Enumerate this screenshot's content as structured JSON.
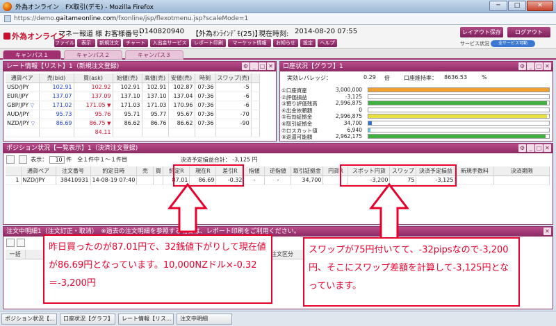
{
  "window": {
    "title": "外為オンライン　FX取引(デモ) - Mozilla Firefox",
    "min": "─",
    "max": "□",
    "close": "✕"
  },
  "urlbar": {
    "scheme": "https://demo.",
    "host": "gaitameonline.com",
    "path": "/fxonline/jsp/flexotmenu.jsp?scaleMode=1"
  },
  "header": {
    "logo": "外為オンライン",
    "user": "マネー報道 様",
    "account_label": "お客様番号：",
    "account": "D140820940",
    "plan": "【外為ｵﾝﾗｲﾝﾃﾞﾓ(25)】",
    "time_label": "現在時刻:",
    "time": "2014-08-20 07:55",
    "menu": [
      "ファイル",
      "表示",
      "新規注文",
      "チャート",
      "入出金サービス",
      "レポート印刷",
      "マーケット情報",
      "お知らせ",
      "設定",
      "ヘルプ"
    ],
    "layout_save": "レイアウト保存",
    "logout": "ログアウト",
    "service_status": "サービス状況",
    "service_badge": "全サービス可動"
  },
  "tabs": [
    "キャンパス１",
    "キャンパス２",
    "キャンパス３"
  ],
  "rate_panel": {
    "title": "レート情報【リスト】1（新規注文登録)",
    "cols": [
      "通貨ペア",
      "売(bid)",
      "買(ask)",
      "始値(売)",
      "高値(売)",
      "安値(売)",
      "時刻",
      "スワップ(売)"
    ],
    "rows": [
      {
        "pair": "USD/JPY",
        "bid": "102.91",
        "ask": "102.92",
        "open": "102.91",
        "high": "102.91",
        "low": "102.87",
        "time": "07:36",
        "swap": "-5",
        "arrow": ""
      },
      {
        "pair": "EUR/JPY",
        "bid": "137.07",
        "ask": "137.09",
        "open": "137.10",
        "high": "137.10",
        "low": "137.04",
        "time": "07:36",
        "swap": "-6",
        "arrow": ""
      },
      {
        "pair": "GBP/JPY",
        "bid": "171.02",
        "ask": "171.05",
        "open": "171.03",
        "high": "171.03",
        "low": "170.96",
        "time": "07:36",
        "swap": "-6",
        "arrow": "▼"
      },
      {
        "pair": "AUD/JPY",
        "bid": "95.73",
        "ask": "95.76",
        "open": "95.71",
        "high": "95.77",
        "low": "95.67",
        "time": "07:36",
        "swap": "-70",
        "arrow": ""
      },
      {
        "pair": "NZD/JPY",
        "bid": "86.69",
        "ask": "86.75",
        "open": "86.62",
        "high": "86.76",
        "low": "86.62",
        "time": "07:36",
        "swap": "-90",
        "arrow": "▼"
      },
      {
        "pair": "",
        "bid": "",
        "ask": "84.11",
        "open": "",
        "high": "",
        "low": "",
        "time": "",
        "swap": "",
        "arrow": ""
      }
    ]
  },
  "acct_panel": {
    "title": "口座状況【グラフ】1",
    "leverage_label": "実効レバレッジ：",
    "leverage": "0.29",
    "leverage_unit": "倍",
    "margin_label": "口座維持率：",
    "margin": "8636.53",
    "margin_unit": "%",
    "rows": [
      {
        "label": "①口座資産",
        "value": "3,000,000",
        "pct": 100,
        "color": "#f0a030"
      },
      {
        "label": "②評価損益",
        "value": "-3,125",
        "pct": 0,
        "color": "#b00000"
      },
      {
        "label": "③預り評価残高",
        "value": "2,996,875",
        "pct": 99,
        "color": "#40b040"
      },
      {
        "label": "④出金依頼額",
        "value": "0",
        "pct": 0,
        "color": "#e040a0"
      },
      {
        "label": "⑤有効証拠金",
        "value": "2,996,875",
        "pct": 99,
        "color": "#e8e040"
      },
      {
        "label": "⑥取引証拠金",
        "value": "34,700",
        "pct": 2,
        "color": "#3070d0"
      },
      {
        "label": "⑦ロスカット値",
        "value": "6,940",
        "pct": 1,
        "color": "#60c0e0"
      },
      {
        "label": "⑧返還可能額",
        "value": "2,962,175",
        "pct": 98,
        "color": "#40b040"
      }
    ]
  },
  "pos_panel": {
    "title": "ポジション状況【一覧表示】1（決済注文登録)",
    "show_label": "表示：",
    "show_value": "10",
    "count": "件　全１件中１～１件目",
    "pnl_label": "決済予定損益合計：",
    "pnl_value": "-3,125 円",
    "cols": [
      "",
      "通貨ペア",
      "注文番号",
      "約定日時",
      "売",
      "買",
      "約定R",
      "現在R",
      "差引R",
      "指値",
      "逆指値",
      "取引証拠金",
      "円貨R",
      "スポット円貨",
      "スワップ",
      "決済予定損益",
      "新規手数料",
      "決済期限"
    ],
    "row": [
      "1",
      "NZD/JPY",
      "38410931",
      "14-08-19 07:40",
      "",
      "",
      "87.01",
      "86.69",
      "-0.32",
      "-",
      "-",
      "34,700",
      "",
      "-3,200",
      "75",
      "-3,125",
      "",
      ""
    ]
  },
  "order_panel": {
    "title": "注文中明細1（注文訂正・取消）　※過去の注文明細を参照する場合は、レポート印刷をご利用ください。",
    "col0": "一括",
    "col1": "",
    "col2": "注文区分"
  },
  "callouts": {
    "left": "昨日買ったのが87.01円で、32銭値下がりして現在値が86.69円となっています。10,000NZドル×-0.32＝-3,200円",
    "right": "スワップが75円付いてて、-32pipsなので-3,200円、そこにスワップ差額を計算して-3,125円となっています。"
  },
  "taskbar": [
    "ポジション状況【...",
    "口座状況【グラフ】",
    "レート情報【リス...",
    "注文中明細"
  ],
  "colors": {
    "accent": "#a03070",
    "highlight": "#e8002d"
  }
}
